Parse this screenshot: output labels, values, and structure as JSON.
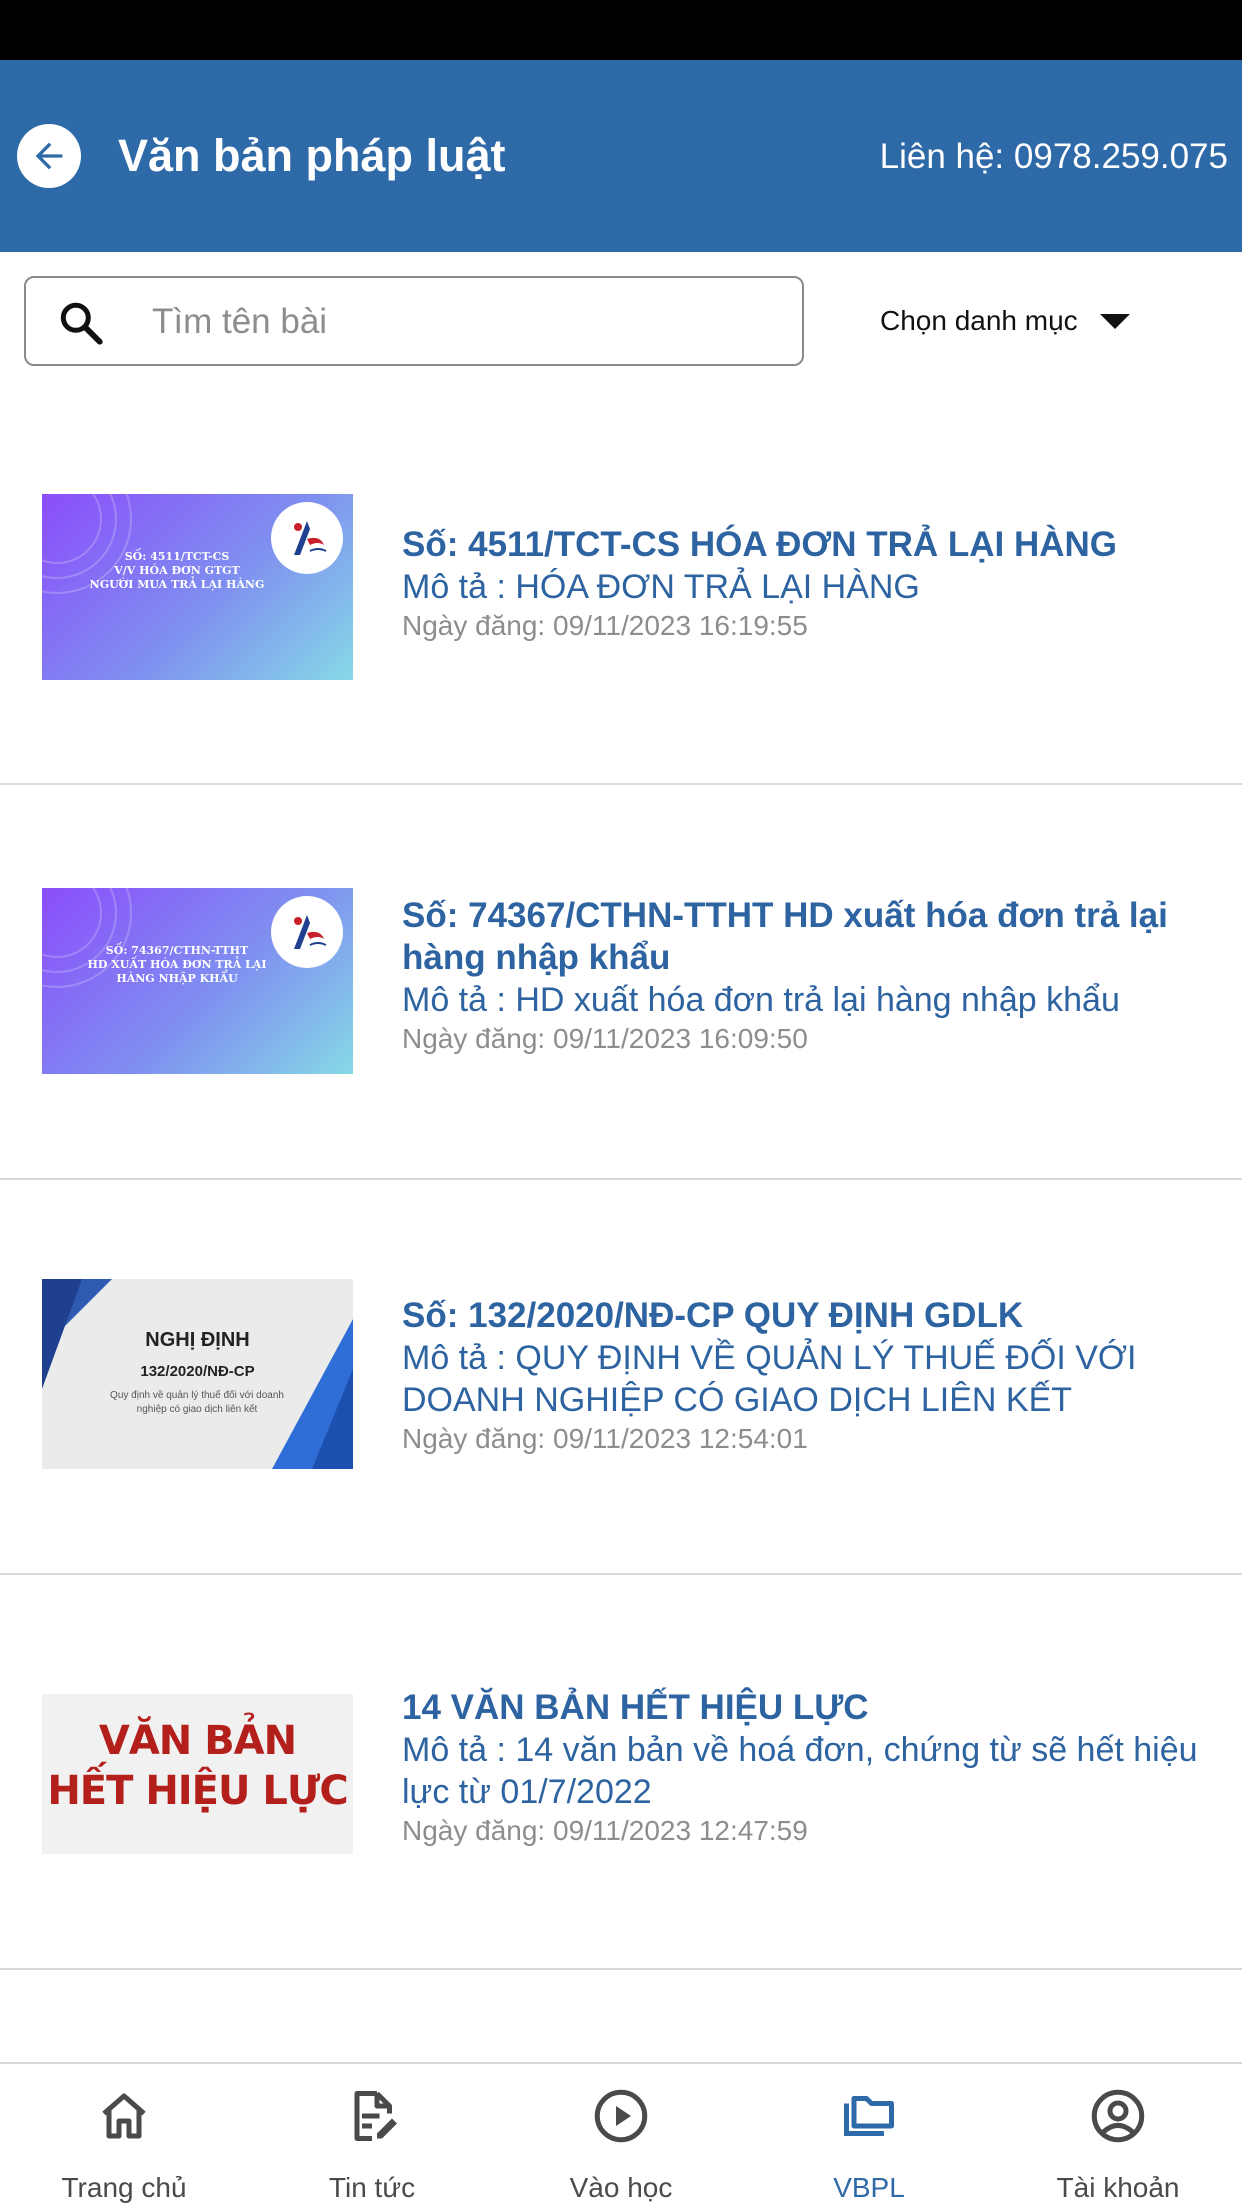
{
  "header": {
    "title": "Văn bản pháp luật",
    "contact": "Liên hệ: 0978.259.075"
  },
  "search": {
    "placeholder": "Tìm tên bài",
    "category_label": "Chọn danh mục"
  },
  "documents": [
    {
      "title": "Số: 4511/TCT-CS HÓA ĐƠN TRẢ LẠI HÀNG",
      "description": "Mô tả : HÓA ĐƠN TRẢ LẠI HÀNG",
      "date": "Ngày đăng: 09/11/2023 16:19:55",
      "thumb_lines": [
        "SỐ: 4511/TCT-CS",
        "V/V HÓA ĐƠN GTGT",
        "NGƯỜI MUA TRẢ LẠI HÀNG"
      ]
    },
    {
      "title": "Số: 74367/CTHN-TTHT HD xuất hóa đơn trả lại hàng nhập khẩu",
      "description": "Mô tả : HD xuất hóa đơn trả lại hàng nhập khẩu",
      "date": "Ngày đăng: 09/11/2023 16:09:50",
      "thumb_lines": [
        "SỐ: 74367/CTHN-TTHT",
        "HD XUẤT HÓA ĐƠN TRẢ LẠI",
        "HÀNG NHẬP KHẨU"
      ]
    },
    {
      "title": "Số: 132/2020/NĐ-CP QUY ĐỊNH GDLK",
      "description": "Mô tả : QUY ĐỊNH VỀ QUẢN LÝ THUẾ ĐỐI VỚI DOANH NGHIỆP CÓ GIAO DỊCH LIÊN KẾT",
      "date": "Ngày đăng: 09/11/2023 12:54:01",
      "thumb_lines": [
        "NGHỊ ĐỊNH",
        "132/2020/NĐ-CP",
        "Quy định về quản lý thuế đối với doanh nghiệp có giao dịch liên kết"
      ]
    },
    {
      "title": "14 VĂN BẢN HẾT HIỆU LỰC",
      "description": "Mô tả : 14 văn bản về hoá đơn, chứng từ sẽ hết hiệu lực từ 01/7/2022",
      "date": "Ngày đăng: 09/11/2023 12:47:59",
      "thumb_lines": [
        "VĂN BẢN",
        "HẾT HIỆU LỰC"
      ]
    }
  ],
  "nav": {
    "home": "Trang chủ",
    "news": "Tin tức",
    "study": "Vào học",
    "vbpl": "VBPL",
    "account": "Tài khoản",
    "active": "VBPL"
  },
  "colors": {
    "brand_blue": "#2f6aa8",
    "title_blue": "#2d63a0",
    "date_grey": "#8d8d8d"
  }
}
